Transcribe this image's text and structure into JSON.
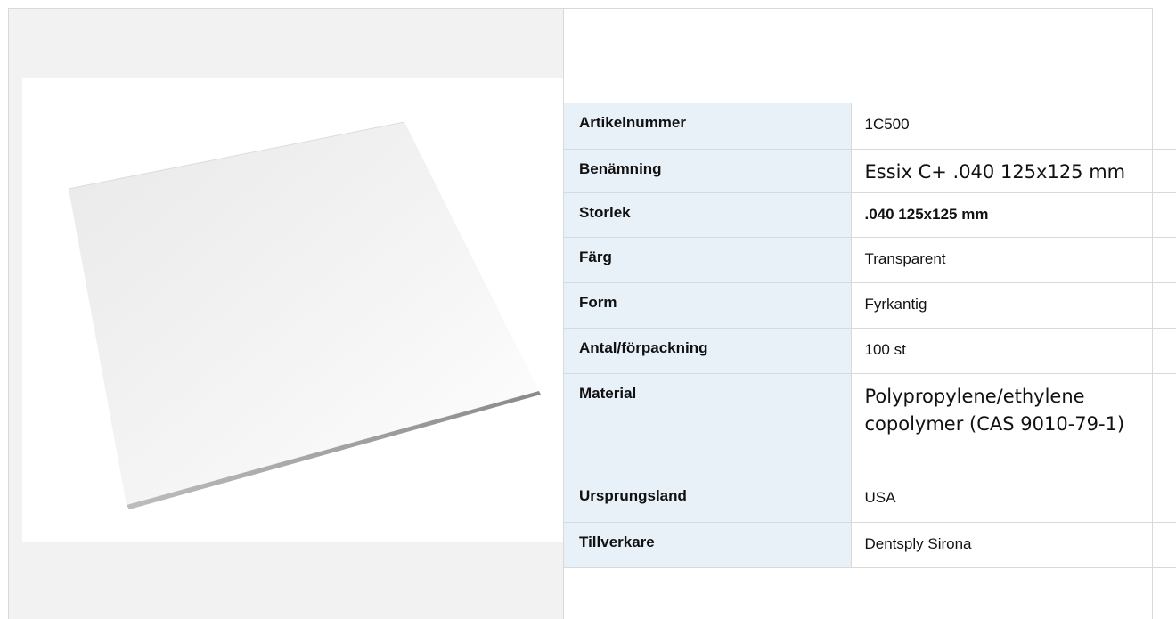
{
  "product_image": {
    "icon": "plastic-sheet-image"
  },
  "specs": {
    "rows": [
      {
        "label": "Artikelnummer",
        "value": "1C500"
      },
      {
        "label": "Benämning",
        "value": "Essix C+ .040 125x125 mm"
      },
      {
        "label": "Storlek",
        "value": ".040 125x125 mm"
      },
      {
        "label": "Färg",
        "value": "Transparent"
      },
      {
        "label": "Form",
        "value": "Fyrkantig"
      },
      {
        "label": "Antal/förpackning",
        "value": "100 st"
      },
      {
        "label": "Material",
        "value_line1": "Polypropylene/ethylene",
        "value_line2": "copolymer (CAS 9010-79-1)"
      },
      {
        "label": "Ursprungsland",
        "value": "USA"
      },
      {
        "label": "Tillverkare",
        "value": "Dentsply Sirona"
      }
    ]
  },
  "colors": {
    "label_bg": "#e8f0f8",
    "border": "#d9d9d9",
    "left_panel_bg": "#f2f2f2"
  }
}
